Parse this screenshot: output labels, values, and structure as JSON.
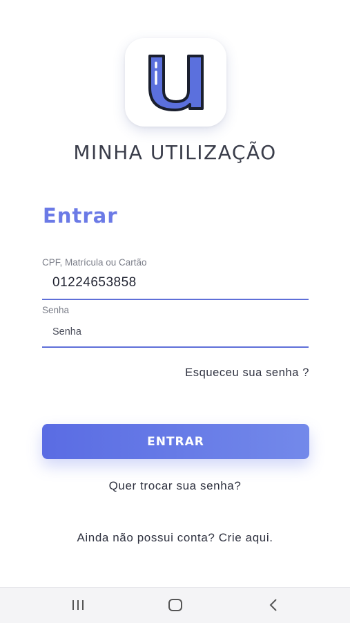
{
  "app": {
    "title": "MINHA UTILIZAÇÃO",
    "logo_icon": "u-letter-logo-icon",
    "brand_color": "#6b7ae6"
  },
  "login": {
    "heading": "Entrar",
    "user_field": {
      "label": "CPF, Matrícula ou Cartão",
      "value": "01224653858"
    },
    "password_field": {
      "label": "Senha",
      "placeholder": "Senha",
      "value": ""
    },
    "forgot_password": "Esqueceu sua senha ?",
    "submit_label": "ENTRAR",
    "change_password": "Quer trocar sua senha?",
    "signup": "Ainda não possui conta? Crie aqui."
  },
  "nav_bar": {
    "recents_icon": "recent-apps-icon",
    "home_icon": "home-icon",
    "back_icon": "back-icon"
  }
}
